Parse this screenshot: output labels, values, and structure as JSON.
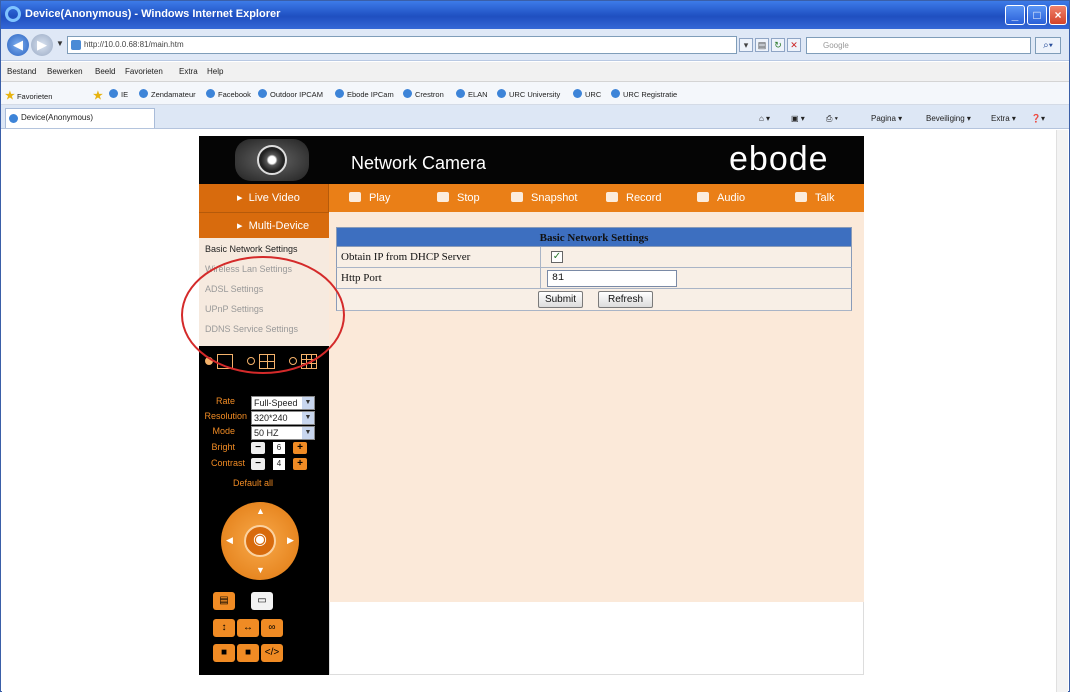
{
  "window": {
    "title": "Device(Anonymous) - Windows Internet Explorer"
  },
  "addressbar": {
    "url": "http://10.0.0.68:81/main.htm",
    "search_placeholder": "Google"
  },
  "menubar": [
    "Bestand",
    "Bewerken",
    "Beeld",
    "Favorieten",
    "Extra",
    "Help"
  ],
  "favorites": {
    "label": "Favorieten",
    "items": [
      "IE",
      "Zendamateur",
      "Facebook",
      "Outdoor IPCAM",
      "Ebode IPCam",
      "Crestron",
      "ELAN",
      "URC University",
      "URC",
      "URC Registratie"
    ]
  },
  "tab": {
    "title": "Device(Anonymous)"
  },
  "commandbar": [
    "Pagina ▾",
    "Beveiliging ▾",
    "Extra ▾"
  ],
  "app": {
    "title": "Network Camera",
    "brand": "ebode",
    "nav": {
      "live_video": "Live Video",
      "play": "Play",
      "stop": "Stop",
      "snapshot": "Snapshot",
      "record": "Record",
      "audio": "Audio",
      "talk": "Talk"
    },
    "multi_device": "Multi-Device",
    "submenu": [
      "Basic Network Settings",
      "Wireless Lan Settings",
      "ADSL Settings",
      "UPnP Settings",
      "DDNS Service Settings"
    ],
    "controls": {
      "rate_label": "Rate",
      "rate_value": "Full-Speed",
      "resolution_label": "Resolution",
      "resolution_value": "320*240",
      "mode_label": "Mode",
      "mode_value": "50 HZ",
      "bright_label": "Bright",
      "bright_value": "6",
      "contrast_label": "Contrast",
      "contrast_value": "4",
      "default_all": "Default all"
    },
    "settings": {
      "header": "Basic Network Settings",
      "dhcp_label": "Obtain IP from DHCP Server",
      "dhcp_checked": "✓",
      "port_label": "Http Port",
      "port_value": "81",
      "submit": "Submit",
      "refresh": "Refresh"
    }
  },
  "colors": {
    "accent": "#ea7f17",
    "header_blue": "#3d6fc0",
    "content_bg": "#fbe9d9",
    "highlight_circle": "#d42a2a"
  }
}
